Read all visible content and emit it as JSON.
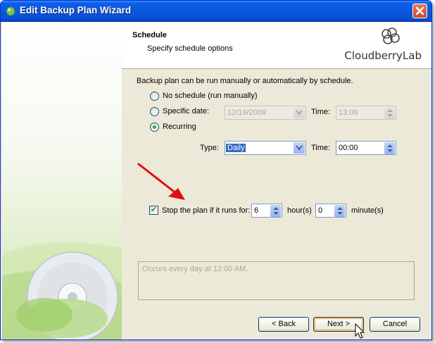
{
  "window": {
    "title": "Edit Backup Plan Wizard"
  },
  "header": {
    "title": "Schedule",
    "subtitle": "Specify schedule options",
    "logo_text": "CloudberryLab"
  },
  "schedule": {
    "intro": "Backup plan can be run manually or automatically by schedule.",
    "options": {
      "no_schedule": "No schedule (run manually)",
      "specific_date": "Specific date:",
      "recurring": "Recurring"
    },
    "selected": "recurring",
    "specific": {
      "date": "12/19/2009",
      "time_label": "Time:",
      "time": "13:09"
    },
    "recurring": {
      "type_label": "Type:",
      "type_value": "Daily",
      "time_label": "Time:",
      "time": "00:00"
    },
    "stop": {
      "checked": true,
      "label": "Stop the plan if it runs for:",
      "hours": "6",
      "hours_unit": "hour(s)",
      "minutes": "0",
      "minutes_unit": "minute(s)"
    },
    "summary": "Occurs every day at 12:00 AM."
  },
  "buttons": {
    "back": "< Back",
    "next": "Next >",
    "cancel": "Cancel"
  },
  "colors": {
    "titlebar": "#0a5fe7",
    "arrow": "#e01010",
    "accent_green": "#2cae2c"
  }
}
